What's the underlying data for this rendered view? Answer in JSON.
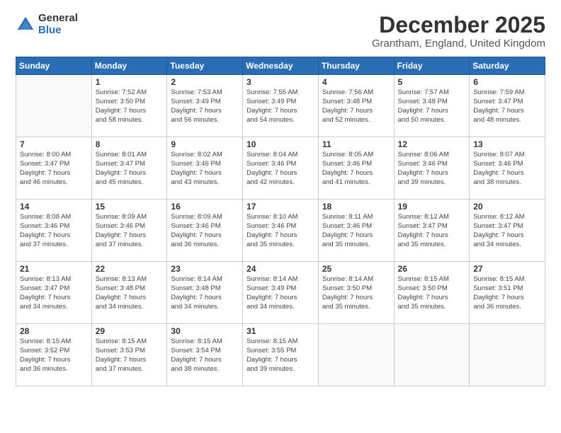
{
  "logo": {
    "general": "General",
    "blue": "Blue"
  },
  "header": {
    "month": "December 2025",
    "location": "Grantham, England, United Kingdom"
  },
  "weekdays": [
    "Sunday",
    "Monday",
    "Tuesday",
    "Wednesday",
    "Thursday",
    "Friday",
    "Saturday"
  ],
  "weeks": [
    [
      {
        "day": "",
        "info": ""
      },
      {
        "day": "1",
        "info": "Sunrise: 7:52 AM\nSunset: 3:50 PM\nDaylight: 7 hours\nand 58 minutes."
      },
      {
        "day": "2",
        "info": "Sunrise: 7:53 AM\nSunset: 3:49 PM\nDaylight: 7 hours\nand 56 minutes."
      },
      {
        "day": "3",
        "info": "Sunrise: 7:55 AM\nSunset: 3:49 PM\nDaylight: 7 hours\nand 54 minutes."
      },
      {
        "day": "4",
        "info": "Sunrise: 7:56 AM\nSunset: 3:48 PM\nDaylight: 7 hours\nand 52 minutes."
      },
      {
        "day": "5",
        "info": "Sunrise: 7:57 AM\nSunset: 3:48 PM\nDaylight: 7 hours\nand 50 minutes."
      },
      {
        "day": "6",
        "info": "Sunrise: 7:59 AM\nSunset: 3:47 PM\nDaylight: 7 hours\nand 48 minutes."
      }
    ],
    [
      {
        "day": "7",
        "info": ""
      },
      {
        "day": "8",
        "info": "Sunrise: 8:01 AM\nSunset: 3:47 PM\nDaylight: 7 hours\nand 45 minutes."
      },
      {
        "day": "9",
        "info": "Sunrise: 8:02 AM\nSunset: 3:46 PM\nDaylight: 7 hours\nand 43 minutes."
      },
      {
        "day": "10",
        "info": "Sunrise: 8:04 AM\nSunset: 3:46 PM\nDaylight: 7 hours\nand 42 minutes."
      },
      {
        "day": "11",
        "info": "Sunrise: 8:05 AM\nSunset: 3:46 PM\nDaylight: 7 hours\nand 41 minutes."
      },
      {
        "day": "12",
        "info": "Sunrise: 8:06 AM\nSunset: 3:46 PM\nDaylight: 7 hours\nand 39 minutes."
      },
      {
        "day": "13",
        "info": "Sunrise: 8:07 AM\nSunset: 3:46 PM\nDaylight: 7 hours\nand 38 minutes."
      }
    ],
    [
      {
        "day": "14",
        "info": ""
      },
      {
        "day": "15",
        "info": "Sunrise: 8:09 AM\nSunset: 3:46 PM\nDaylight: 7 hours\nand 37 minutes."
      },
      {
        "day": "16",
        "info": "Sunrise: 8:09 AM\nSunset: 3:46 PM\nDaylight: 7 hours\nand 36 minutes."
      },
      {
        "day": "17",
        "info": "Sunrise: 8:10 AM\nSunset: 3:46 PM\nDaylight: 7 hours\nand 35 minutes."
      },
      {
        "day": "18",
        "info": "Sunrise: 8:11 AM\nSunset: 3:46 PM\nDaylight: 7 hours\nand 35 minutes."
      },
      {
        "day": "19",
        "info": "Sunrise: 8:12 AM\nSunset: 3:47 PM\nDaylight: 7 hours\nand 35 minutes."
      },
      {
        "day": "20",
        "info": "Sunrise: 8:12 AM\nSunset: 3:47 PM\nDaylight: 7 hours\nand 34 minutes."
      }
    ],
    [
      {
        "day": "21",
        "info": ""
      },
      {
        "day": "22",
        "info": "Sunrise: 8:13 AM\nSunset: 3:48 PM\nDaylight: 7 hours\nand 34 minutes."
      },
      {
        "day": "23",
        "info": "Sunrise: 8:14 AM\nSunset: 3:48 PM\nDaylight: 7 hours\nand 34 minutes."
      },
      {
        "day": "24",
        "info": "Sunrise: 8:14 AM\nSunset: 3:49 PM\nDaylight: 7 hours\nand 34 minutes."
      },
      {
        "day": "25",
        "info": "Sunrise: 8:14 AM\nSunset: 3:50 PM\nDaylight: 7 hours\nand 35 minutes."
      },
      {
        "day": "26",
        "info": "Sunrise: 8:15 AM\nSunset: 3:50 PM\nDaylight: 7 hours\nand 35 minutes."
      },
      {
        "day": "27",
        "info": "Sunrise: 8:15 AM\nSunset: 3:51 PM\nDaylight: 7 hours\nand 36 minutes."
      }
    ],
    [
      {
        "day": "28",
        "info": "Sunrise: 8:15 AM\nSunset: 3:52 PM\nDaylight: 7 hours\nand 36 minutes."
      },
      {
        "day": "29",
        "info": "Sunrise: 8:15 AM\nSunset: 3:53 PM\nDaylight: 7 hours\nand 37 minutes."
      },
      {
        "day": "30",
        "info": "Sunrise: 8:15 AM\nSunset: 3:54 PM\nDaylight: 7 hours\nand 38 minutes."
      },
      {
        "day": "31",
        "info": "Sunrise: 8:15 AM\nSunset: 3:55 PM\nDaylight: 7 hours\nand 39 minutes."
      },
      {
        "day": "",
        "info": ""
      },
      {
        "day": "",
        "info": ""
      },
      {
        "day": "",
        "info": ""
      }
    ]
  ],
  "week7_sunday_info": "Sunrise: 8:00 AM\nSunset: 3:47 PM\nDaylight: 7 hours\nand 46 minutes.",
  "week14_sunday_info": "Sunrise: 8:08 AM\nSunset: 3:46 PM\nDaylight: 7 hours\nand 37 minutes.",
  "week21_sunday_info": "Sunrise: 8:13 AM\nSunset: 3:47 PM\nDaylight: 7 hours\nand 34 minutes."
}
